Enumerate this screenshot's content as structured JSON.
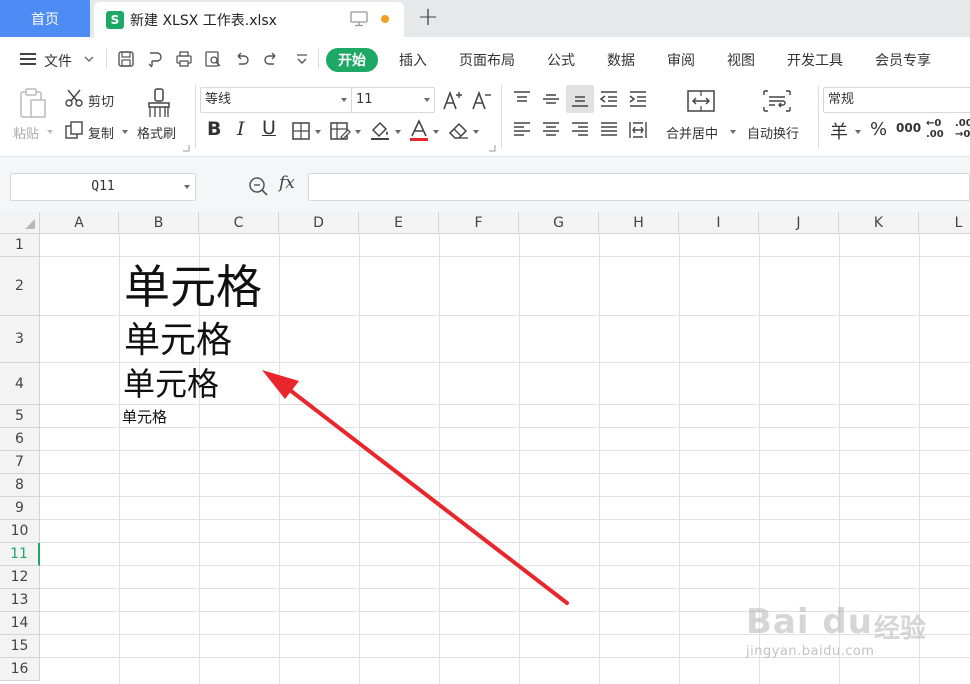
{
  "tabs": {
    "home": "首页",
    "file_icon_letter": "S",
    "file_title": "新建 XLSX 工作表.xlsx",
    "add": "+"
  },
  "menu": {
    "file": "文件",
    "tabs": [
      "开始",
      "插入",
      "页面布局",
      "公式",
      "数据",
      "审阅",
      "视图",
      "开发工具",
      "会员专享"
    ],
    "active_tab": "开始"
  },
  "ribbon": {
    "paste": "粘贴",
    "cut": "剪切",
    "copy": "复制",
    "format_painter": "格式刷",
    "font_name": "等线",
    "font_size": "11",
    "bold": "B",
    "italic": "I",
    "underline": "U",
    "merge_center": "合并居中",
    "wrap_text": "自动换行",
    "number_format": "常规",
    "currency": "羊",
    "percent": "%",
    "thousands": "000",
    "inc_decimal": "←0\n.00",
    "dec_decimal": ".00\n→0"
  },
  "formula_bar": {
    "name_box": "Q11",
    "fx": "fx",
    "formula": ""
  },
  "grid": {
    "columns": [
      "A",
      "B",
      "C",
      "D",
      "E",
      "F",
      "G",
      "H",
      "I",
      "J",
      "K",
      "L"
    ],
    "rows": [
      "1",
      "2",
      "3",
      "4",
      "5",
      "6",
      "7",
      "8",
      "9",
      "10",
      "11",
      "12",
      "13",
      "14",
      "15",
      "16"
    ],
    "active_row": "11",
    "cells": {
      "B2": "单元格",
      "B3": "单元格",
      "B4": "单元格",
      "B5": "单元格"
    }
  },
  "colors": {
    "accent": "#1ea866",
    "home_tab": "#4d8bf5",
    "arrow": "#e8262c"
  },
  "watermark": {
    "brand": "Bai du",
    "cn": "经验",
    "url": "jingyan.baidu.com"
  }
}
